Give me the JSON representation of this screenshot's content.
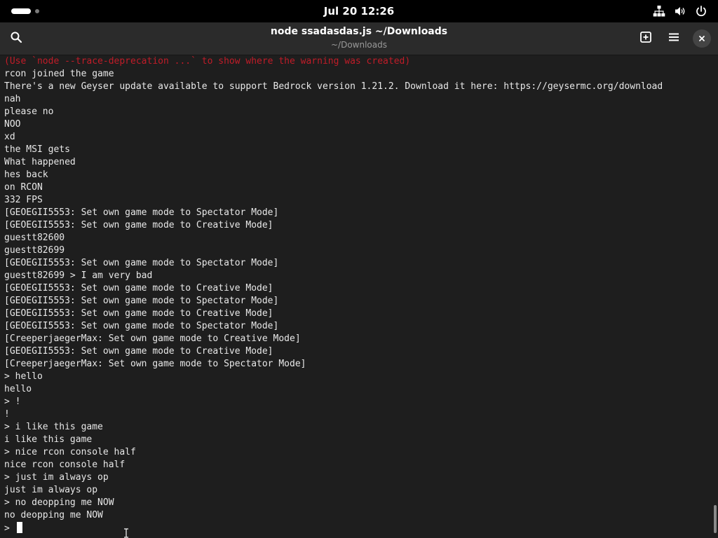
{
  "system_bar": {
    "clock": "Jul 20  12:26",
    "icons": [
      "network-icon",
      "volume-icon",
      "power-icon"
    ]
  },
  "window": {
    "title": "node ssadasdas.js ~/Downloads",
    "subtitle": "~/Downloads",
    "buttons": [
      "search-icon",
      "new-tab-icon",
      "menu-icon",
      "close-icon"
    ]
  },
  "colors": {
    "terminal_bg": "#1e1e1e",
    "terminal_fg": "#e8e8e8",
    "warning": "#c01c28",
    "header_bg": "#2b2b2b",
    "topbar_bg": "#000000"
  },
  "terminal": {
    "lines": [
      {
        "text": "(Use `node --trace-deprecation ...` to show where the warning was created)",
        "kind": "warn"
      },
      {
        "text": "rcon joined the game"
      },
      {
        "text": "There's a new Geyser update available to support Bedrock version 1.21.2. Download it here: https://geysermc.org/download"
      },
      {
        "text": "nah"
      },
      {
        "text": "please no"
      },
      {
        "text": "NOO"
      },
      {
        "text": "xd"
      },
      {
        "text": "the MSI gets"
      },
      {
        "text": "What happened"
      },
      {
        "text": "hes back"
      },
      {
        "text": "on RCON"
      },
      {
        "text": "332 FPS"
      },
      {
        "text": "[GEOEGII5553: Set own game mode to Spectator Mode]"
      },
      {
        "text": "[GEOEGII5553: Set own game mode to Creative Mode]"
      },
      {
        "text": "guestt82600"
      },
      {
        "text": "guestt82699"
      },
      {
        "text": "[GEOEGII5553: Set own game mode to Spectator Mode]"
      },
      {
        "text": "guestt82699 > I am very bad"
      },
      {
        "text": "[GEOEGII5553: Set own game mode to Creative Mode]"
      },
      {
        "text": "[GEOEGII5553: Set own game mode to Spectator Mode]"
      },
      {
        "text": "[GEOEGII5553: Set own game mode to Creative Mode]"
      },
      {
        "text": "[GEOEGII5553: Set own game mode to Spectator Mode]"
      },
      {
        "text": "[CreeperjaegerMax: Set own game mode to Creative Mode]"
      },
      {
        "text": "[GEOEGII5553: Set own game mode to Creative Mode]"
      },
      {
        "text": "[CreeperjaegerMax: Set own game mode to Spectator Mode]"
      },
      {
        "text": "> hello"
      },
      {
        "text": "hello"
      },
      {
        "text": "> !"
      },
      {
        "text": "!"
      },
      {
        "text": "> i like this game"
      },
      {
        "text": "i like this game"
      },
      {
        "text": "> nice rcon console half"
      },
      {
        "text": "nice rcon console half"
      },
      {
        "text": "> just im always op"
      },
      {
        "text": "just im always op"
      },
      {
        "text": "> no deopping me NOW"
      },
      {
        "text": "no deopping me NOW"
      }
    ],
    "prompt": "> "
  }
}
